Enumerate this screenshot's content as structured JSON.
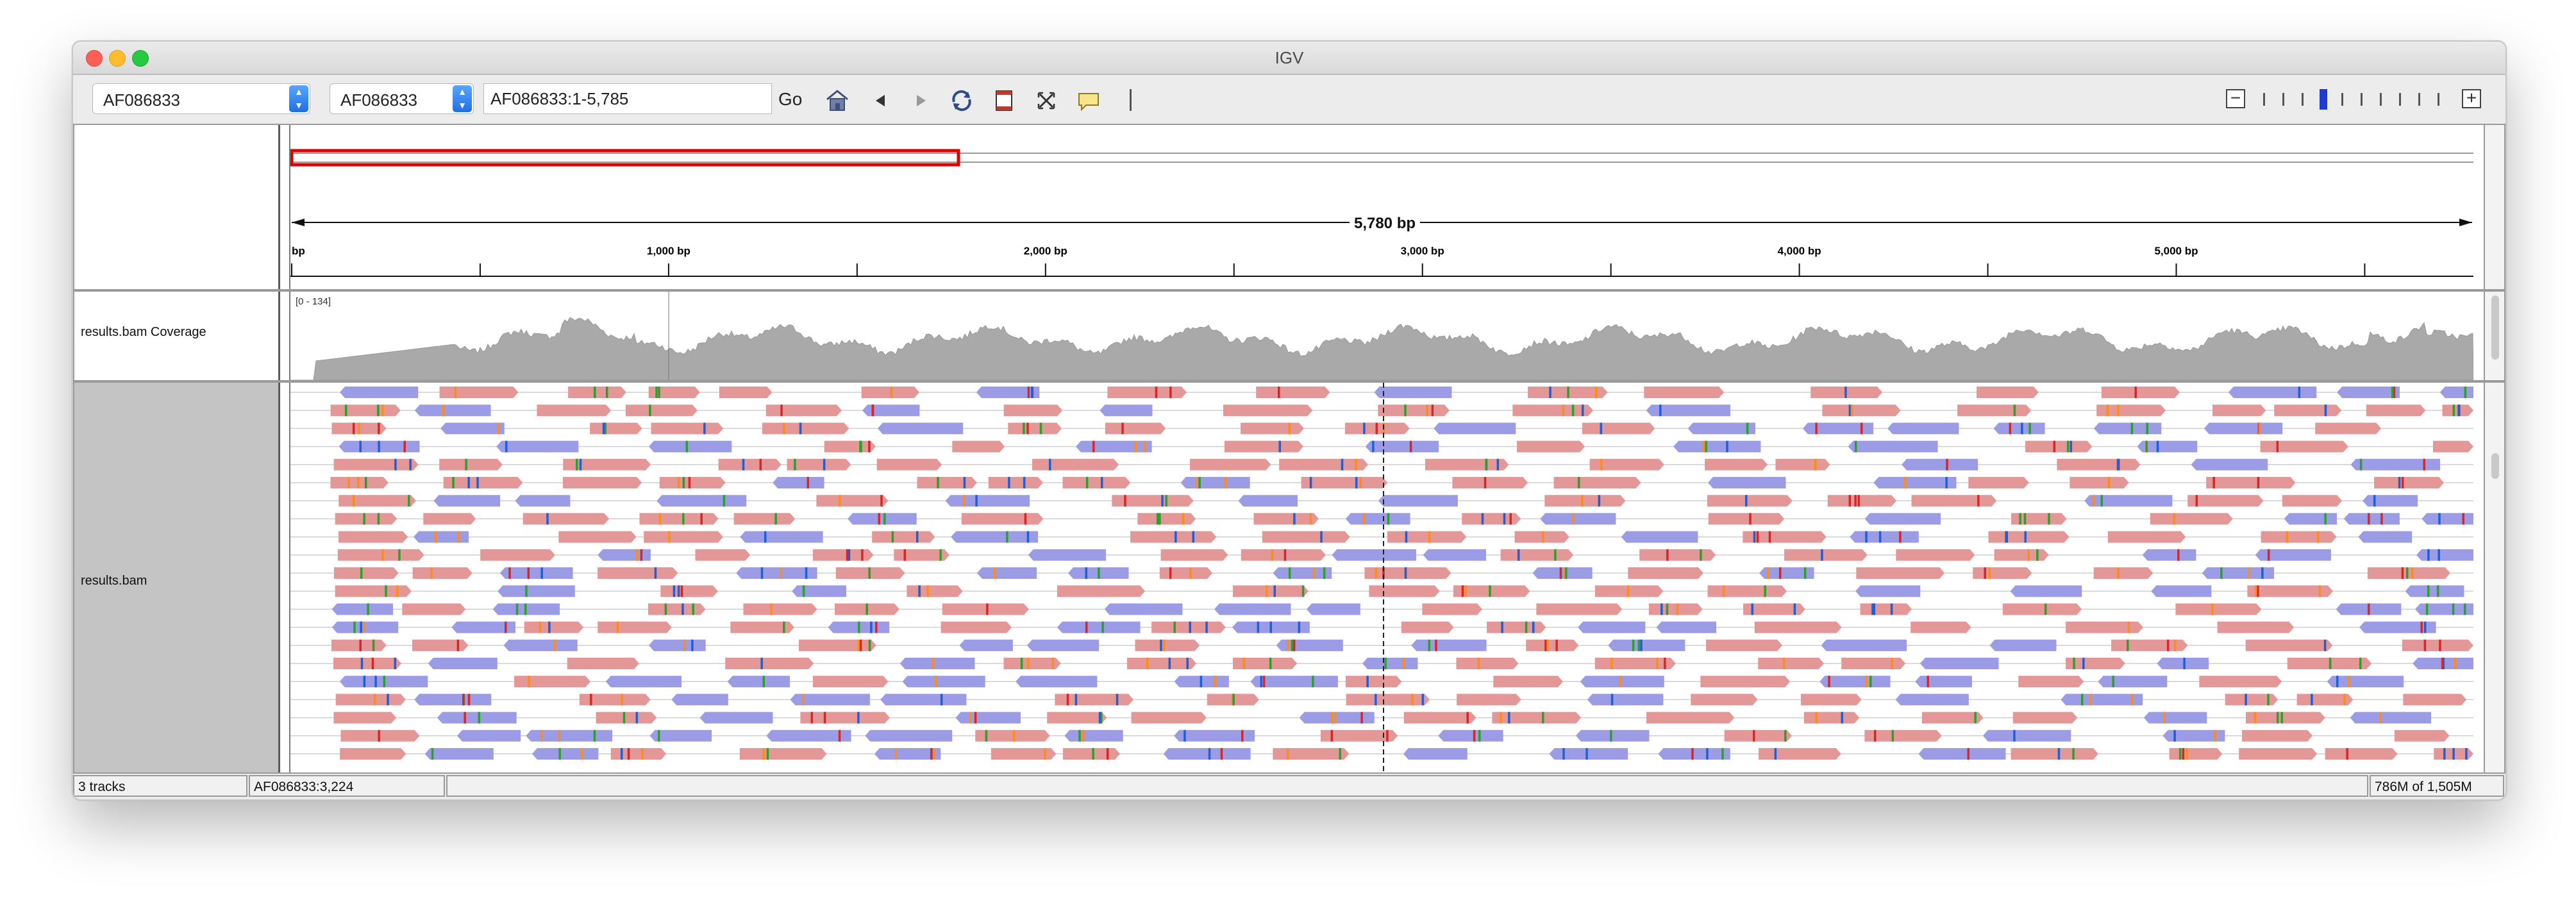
{
  "window": {
    "title": "IGV"
  },
  "toolbar": {
    "genome": "AF086833",
    "chromosome": "AF086833",
    "locus": "AF086833:1-5,785",
    "go_label": "Go"
  },
  "ruler": {
    "span_label": "5,780 bp",
    "ticks": [
      "bp",
      "1,000 bp",
      "2,000 bp",
      "3,000 bp",
      "4,000 bp",
      "5,000 bp"
    ]
  },
  "tracks": {
    "coverage_name": "results.bam Coverage",
    "coverage_range": "[0 - 134]",
    "alignment_name": "results.bam"
  },
  "status": {
    "tracks": "3 tracks",
    "position": "AF086833:3,224",
    "memory": "786M of 1,505M"
  },
  "colors": {
    "forward_read": "#e39797",
    "reverse_read": "#9c9ce6",
    "coverage": "#a9a9a9",
    "region_box": "#e00000"
  }
}
